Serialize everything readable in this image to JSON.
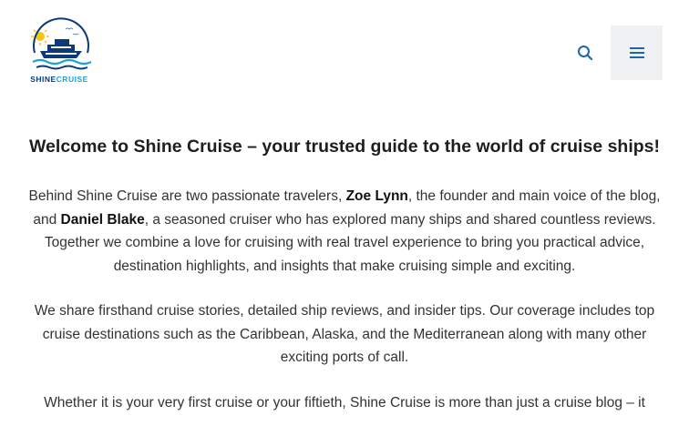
{
  "header": {
    "logo_word1": "SHINE",
    "logo_word2": "CRUISE"
  },
  "main": {
    "heading": "Welcome to Shine Cruise – your trusted guide to the world of cruise ships!",
    "p1": {
      "a": "Behind Shine Cruise are two passionate travelers, ",
      "name1": "Zoe Lynn",
      "b": ", the founder and main voice of the blog, and ",
      "name2": "Daniel Blake",
      "c": ", a seasoned cruiser who has explored many ships and shared countless reviews. Together we combine a love for cruising with real travel experience to bring you practical advice, destination highlights, and insights that make cruising simple and exciting."
    },
    "p2": "We share firsthand cruise stories, detailed ship reviews, and insider tips. Our coverage includes top cruise destinations such as the Caribbean, Alaska, and the Mediterranean along with many other exciting ports of call.",
    "p3": "Whether it is your very first cruise or your fiftieth, Shine Cruise is more than just a cruise blog – it"
  },
  "colors": {
    "brand_navy": "#0b3a78",
    "brand_cyan": "#1aa3d9",
    "sun": "#f5c518",
    "menu_bg": "#f0f1f3",
    "icon": "#1b66b3"
  },
  "icons": {
    "search": "search-icon",
    "menu": "hamburger-menu-icon",
    "logo": "cruise-ship-logo-icon"
  }
}
